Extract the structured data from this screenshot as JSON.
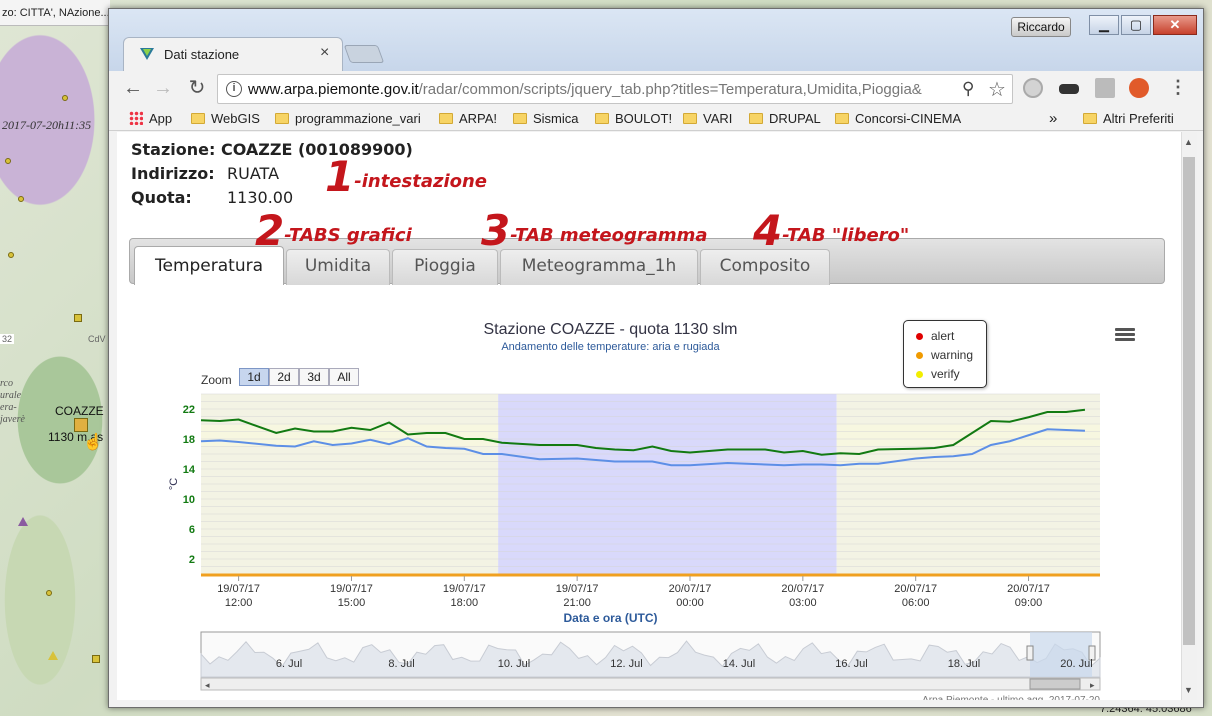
{
  "background_map": {
    "title_fragment": "zo: CITTA', NAzione...",
    "timestamp": "2017-07-20h11:35",
    "station_label": "COAZZE",
    "station_quota": "1130 m.as",
    "road_badge": "32",
    "place_abbrev": "CdV",
    "side_labels": [
      "rco",
      "urale",
      "era-",
      "javerè"
    ],
    "coords": "7.24364. 45.03686"
  },
  "browser": {
    "tab_title": "Dati stazione",
    "user_button": "Riccardo",
    "url_domain": "www.arpa.piemonte.gov.it",
    "url_path": "/radar/common/scripts/jquery_tab.php?titles=Temperatura,Umidita,Pioggia&",
    "bookmarks": [
      "App",
      "WebGIS",
      "programmazione_vari",
      "ARPA!",
      "Sismica",
      "BOULOT!",
      "VARI",
      "DRUPAL",
      "Concorsi-CINEMA"
    ],
    "overflow": "»",
    "other_bookmarks": "Altri Preferiti"
  },
  "header": {
    "station_label": "Stazione:",
    "station_value": "COAZZE (001089900)",
    "address_label": "Indirizzo:",
    "address_value": "RUATA",
    "quota_label": "Quota:",
    "quota_value": "1130.00"
  },
  "annotations": [
    {
      "num": "1",
      "text": "-intestazione"
    },
    {
      "num": "2",
      "text": "-TABS grafici"
    },
    {
      "num": "3",
      "text": "-TAB meteogramma"
    },
    {
      "num": "4",
      "text": "-TAB \"libero\""
    }
  ],
  "tabs": [
    "Temperatura",
    "Umidita",
    "Pioggia",
    "Meteogramma_1h",
    "Composito"
  ],
  "active_tab": "Temperatura",
  "chart_data": {
    "type": "line",
    "title": "Stazione COAZZE - quota 1130 slm",
    "subtitle": "Andamento delle temperature: aria e rugiada",
    "xlabel": "Data e ora (UTC)",
    "ylabel": "°C",
    "yticks": [
      2,
      6,
      10,
      14,
      18,
      22
    ],
    "ylim": [
      0,
      24
    ],
    "x_ticks": [
      {
        "date": "19/07/17",
        "time": "12:00"
      },
      {
        "date": "19/07/17",
        "time": "15:00"
      },
      {
        "date": "19/07/17",
        "time": "18:00"
      },
      {
        "date": "19/07/17",
        "time": "21:00"
      },
      {
        "date": "20/07/17",
        "time": "00:00"
      },
      {
        "date": "20/07/17",
        "time": "03:00"
      },
      {
        "date": "20/07/17",
        "time": "06:00"
      },
      {
        "date": "20/07/17",
        "time": "09:00"
      }
    ],
    "xlim_hours_from_first_tick": [
      -1,
      22.9
    ],
    "night_band_hours": [
      6.9,
      15.9
    ],
    "x_hours": [
      -1,
      -0.5,
      0,
      1,
      1.5,
      2,
      2.5,
      3,
      3.5,
      4,
      4.5,
      5,
      5.5,
      6,
      6.5,
      7,
      8,
      9,
      9.5,
      10,
      10.5,
      11,
      11.5,
      12,
      13,
      14,
      14.5,
      15,
      15.5,
      16,
      16.5,
      17,
      18,
      18.5,
      19,
      19.5,
      20,
      20.5,
      21,
      21.5,
      22,
      22.5
    ],
    "series": [
      {
        "color": "#127a12",
        "values": [
          20.5,
          20.4,
          20.6,
          18.8,
          19.4,
          19.0,
          19.0,
          19.5,
          19.2,
          20.2,
          18.6,
          18.8,
          18.8,
          18.0,
          18.0,
          17.5,
          17.2,
          17.2,
          16.8,
          16.6,
          16.5,
          17.0,
          16.4,
          16.2,
          16.6,
          16.6,
          16.2,
          16.4,
          15.9,
          16.1,
          16.0,
          16.6,
          16.7,
          16.8,
          17.2,
          18.8,
          20.4,
          20.3,
          20.9,
          21.6,
          21.6,
          21.9
        ]
      },
      {
        "color": "#5d8fe6",
        "values": [
          17.7,
          17.8,
          17.6,
          17.1,
          17.0,
          17.7,
          17.2,
          17.4,
          17.9,
          17.3,
          18.1,
          17.0,
          16.8,
          16.7,
          16.0,
          16.0,
          15.3,
          15.4,
          15.2,
          15.0,
          15.0,
          15.0,
          14.5,
          14.5,
          14.8,
          14.6,
          14.5,
          14.6,
          14.6,
          14.5,
          14.7,
          14.7,
          15.4,
          15.6,
          15.7,
          16.0,
          17.2,
          17.7,
          18.5,
          19.3,
          19.2,
          19.1
        ]
      }
    ],
    "legend": [
      {
        "label": "alert",
        "color": "#e00000"
      },
      {
        "label": "warning",
        "color": "#f09a00"
      },
      {
        "label": "verify",
        "color": "#f2ee00"
      }
    ],
    "range_selector": [
      "1d",
      "2d",
      "3d",
      "All"
    ],
    "range_selected": "1d",
    "zoom_label": "Zoom",
    "navigator_labels": [
      "6. Jul",
      "8. Jul",
      "10. Jul",
      "12. Jul",
      "14. Jul",
      "16. Jul",
      "18. Jul",
      "20. Jul"
    ],
    "credits": "Arpa Piemonte - ultimo agg. 2017-07-20"
  }
}
